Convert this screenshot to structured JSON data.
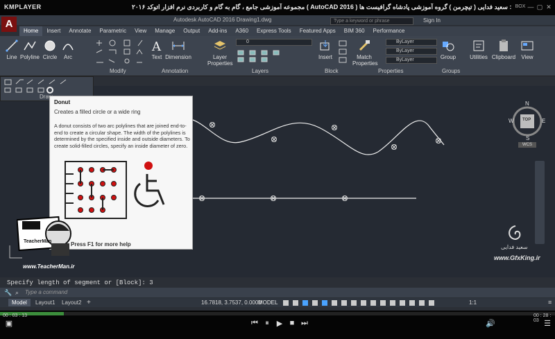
{
  "player": {
    "brand": "KMPLAYER",
    "title": "مجموعه آموزشی جامع ، گام به گام و کاربردی نرم افزار اتوکد ۲۰۱۶ ( AutoCAD 2016 )   مدرس : سعید فدایی ( تیچرمن ) گروه آموزشی پادشاه گرافیست ها",
    "time_current": "00 : 03 : 13",
    "time_total": "00 : 28 : 03",
    "progress_fraction": 0.115,
    "box_label": "BOX"
  },
  "autocad": {
    "logo": "A",
    "doc_title": "Autodesk AutoCAD 2016    Drawing1.dwg",
    "search_placeholder": "Type a keyword or phrase",
    "sign_in": "Sign In",
    "tabs": [
      "Home",
      "Insert",
      "Annotate",
      "Parametric",
      "View",
      "Manage",
      "Output",
      "Add-ins",
      "A360",
      "Express Tools",
      "Featured Apps",
      "BIM 360",
      "Performance"
    ],
    "active_tab": "Home",
    "ribbon_buttons": {
      "line": "Line",
      "polyline": "Polyline",
      "circle": "Circle",
      "arc": "Arc",
      "text": "Text",
      "dimension": "Dimension",
      "layer_properties": "Layer Properties",
      "insert": "Insert",
      "match_properties": "Match Properties",
      "group": "Group",
      "utilities": "Utilities",
      "clipboard": "Clipboard",
      "view": "View"
    },
    "panels": {
      "modify": "Modify",
      "annotation": "Annotation",
      "layers": "Layers",
      "block": "Block",
      "properties": "Properties",
      "groups": "Groups",
      "draw": "Draw"
    },
    "layer_value": "0",
    "bylayer": [
      "ByLayer",
      "ByLayer",
      "ByLayer"
    ],
    "viewcube": {
      "top": "TOP",
      "n": "N",
      "s": "S",
      "e": "E",
      "w": "W",
      "wcs": "WCS"
    },
    "tooltip": {
      "title": "Donut",
      "short": "Creates a filled circle or a wide ring",
      "description": "A donut consists of two arc polylines that are joined end-to-end to create a circular shape. The width of the polylines is determined by the specified inside and outside diameters. To create solid-filled circles, specify an inside diameter of zero.",
      "more_help": "Press F1 for more help"
    },
    "command_history": "Specify length of segment or [Block]: 3",
    "command_placeholder": "Type a command",
    "layout_tabs": [
      "Model",
      "Layout1",
      "Layout2"
    ],
    "coordinates": "16.7818, 3.7537, 0.0000",
    "model_label": "MODEL",
    "scale": "1:1"
  },
  "watermarks": {
    "teacher_badge": "TeacherMan",
    "teacher_site": "www.TeacherMan.ir",
    "author_name": "سعید فدایی",
    "site": "www.GfxKing.ir"
  },
  "colors": {
    "canvas": "#252a33",
    "ribbon": "#3d444f",
    "accent_red": "#d01010",
    "progress": "#3c8e3c"
  }
}
